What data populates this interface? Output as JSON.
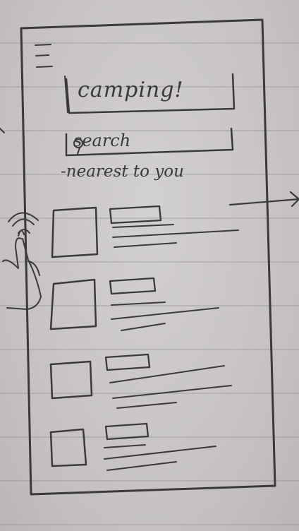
{
  "sketch": {
    "title": "camping!",
    "search_label": "search",
    "section_label": "-nearest to you",
    "icons": {
      "menu": "hamburger-menu-icon",
      "search": "magnifier-icon",
      "tap": "tap-hand-icon",
      "arrow": "right-arrow"
    },
    "list_items": [
      {
        "kind": "thumbnail-with-title-and-lines"
      },
      {
        "kind": "thumbnail-with-title-and-lines"
      },
      {
        "kind": "thumbnail-with-title-and-lines"
      },
      {
        "kind": "thumbnail-with-title-and-lines"
      }
    ],
    "colors": {
      "paper": "#c9c6c5",
      "pencil": "#3b3a3a",
      "rule_line": "#7f7f88"
    }
  }
}
